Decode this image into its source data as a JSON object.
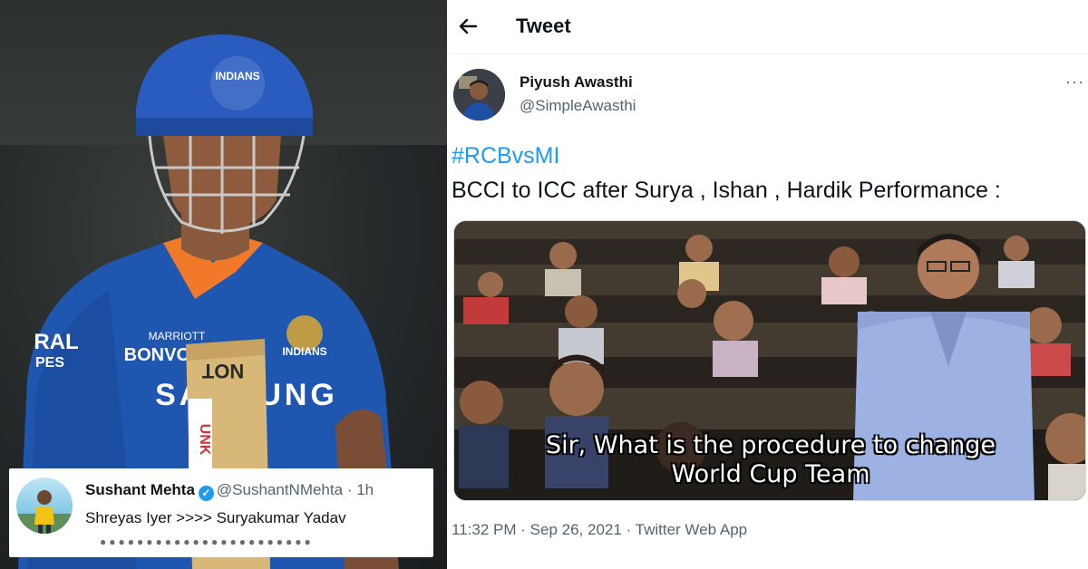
{
  "photo": {
    "helmet_logo": "INDIANS",
    "sponsor_1": "MARRIOTT",
    "sponsor_2": "BONVOY",
    "shirt_left": "RAL",
    "shirt_left_2": "PES",
    "shirt_sponsor": "SAMSUNG",
    "bat_label": "NOT",
    "bat_side": "UNK"
  },
  "mini_tweet": {
    "name": "Sushant Mehta",
    "handle": "@SushantNMehta",
    "separator": "·",
    "time": "1h",
    "text": "Shreyas Iyer >>>> Suryakumar Yadav",
    "emojis": "●●●●●●●●●●●●●●●●●●●●●●●",
    "verified_icon": "✓"
  },
  "header": {
    "back_icon": "arrow-left-icon",
    "title": "Tweet"
  },
  "tweet": {
    "author_name": "Piyush Awasthi",
    "author_handle": "@SimpleAwasthi",
    "more_label": "···",
    "hashtag": "#RCBvsMI",
    "text": "BCCI to ICC after Surya , Ishan , Hardik Performance :",
    "meme_line_1": "Sir, What is the procedure to change",
    "meme_line_2": "World Cup Team",
    "time": "11:32 PM",
    "date": "Sep 26, 2021",
    "source": "Twitter Web App",
    "meta_sep": "·"
  },
  "colors": {
    "link": "#1d9bf0",
    "secondary_text": "#536471",
    "mi_blue": "#1f4fa3"
  }
}
